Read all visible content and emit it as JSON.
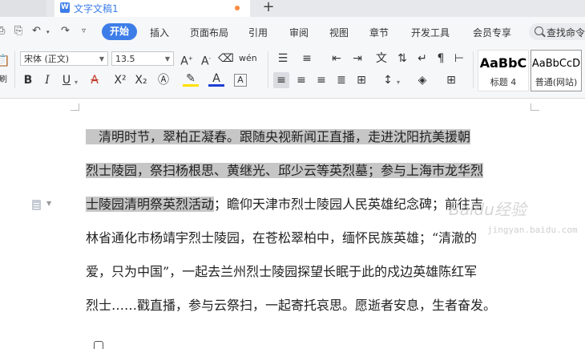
{
  "tabs": {
    "document_title": "文字文稿1",
    "doc_icon": "W",
    "new_tab_label": "+"
  },
  "menu": {
    "items": [
      "开始",
      "插入",
      "页面布局",
      "引用",
      "审阅",
      "视图",
      "章节",
      "开发工具",
      "会员专享"
    ],
    "search_label": "查找命令"
  },
  "ribbon": {
    "font_name": "宋体 (正文)",
    "font_size": "13.5",
    "styles": [
      {
        "sample": "AaBbC",
        "name": "标题 4"
      },
      {
        "sample": "AaBbCcD",
        "name": "普通(网站)"
      }
    ],
    "accent": "#3d7de8",
    "font_color_bar": "#1f3fd6",
    "highlight_bar": "#ffe100"
  },
  "document": {
    "lines": [
      {
        "pre": "",
        "hl": "　清明时节，翠柏正凝春。跟随央视新闻正直播，走进沈阳抗美援朝",
        "post": ""
      },
      {
        "pre": "",
        "hl": "烈士陵园，祭扫杨根思、黄继光、邱少云等英烈墓；参与上海市龙华烈",
        "post": ""
      },
      {
        "pre": "",
        "hl": "士陵园清明祭英烈活动",
        "post": "；瞻仰天津市烈士陵园人民英雄纪念碑；前往吉"
      },
      {
        "pre": "林省通化市杨靖宇烈士陵园，在苍松翠柏中，缅怀民族英雄；“清澈的",
        "hl": "",
        "post": ""
      },
      {
        "pre": "爱，只为中国”，一起去兰州烈士陵园探望长眠于此的戍边英雄陈红军",
        "hl": "",
        "post": ""
      },
      {
        "pre": "烈士……戳直播，参与云祭扫，一起寄托哀思。愿逝者安息，生者奋发。",
        "hl": "",
        "post": ""
      }
    ],
    "selection_color": "#c6c6c6"
  },
  "watermark": {
    "main": "Baidu经验",
    "sub": "jingyan.baidu.com"
  }
}
